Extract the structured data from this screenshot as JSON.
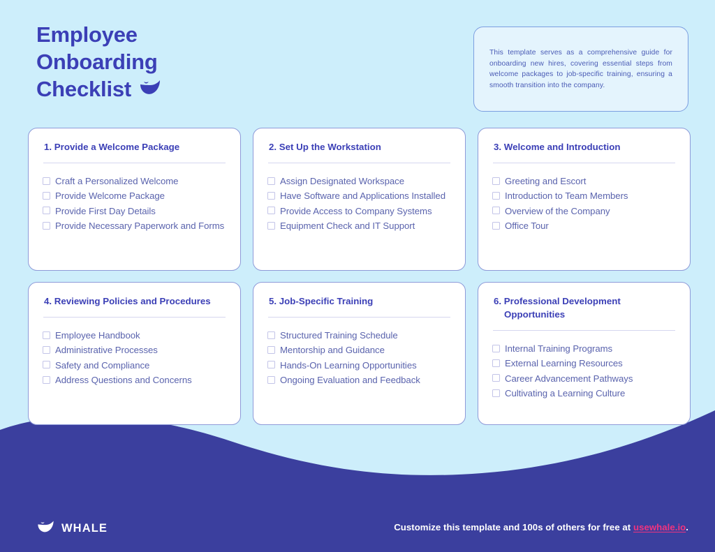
{
  "theme": {
    "background": "#cdeefb",
    "wave": "#3b3f9e",
    "primary_text": "#3b3fb6",
    "body_text": "#5a63ad",
    "card_bg": "#ffffff",
    "card_border": "#8e9ad8",
    "desc_bg": "#e4f4fd",
    "desc_border": "#7c9ee0",
    "link": "#f0337f",
    "checkbox_border": "#c3c4e8"
  },
  "header": {
    "title_lines": [
      "Employee",
      "Onboarding",
      "Checklist"
    ],
    "mark": "whale-smile-icon"
  },
  "description": {
    "text": "This template serves as a comprehensive guide for onboarding new hires, covering essential steps from welcome packages to job-specific training, ensuring a smooth transition into the company."
  },
  "cards": [
    {
      "title": "1. Provide a Welcome Package",
      "items": [
        "Craft a Personalized Welcome",
        "Provide Welcome Package",
        "Provide First Day Details",
        "Provide Necessary Paperwork and Forms"
      ]
    },
    {
      "title": "2. Set Up the Workstation",
      "items": [
        "Assign Designated Workspace",
        "Have Software and Applications Installed",
        "Provide Access to Company Systems",
        "Equipment Check and IT Support"
      ]
    },
    {
      "title": "3. Welcome and Introduction",
      "items": [
        "Greeting and Escort",
        "Introduction to Team Members",
        "Overview of the Company",
        "Office Tour"
      ]
    },
    {
      "title": "4. Reviewing Policies and Procedures",
      "items": [
        "Employee Handbook",
        "Administrative Processes",
        "Safety and Compliance",
        "Address Questions and Concerns"
      ]
    },
    {
      "title": "5. Job-Specific Training",
      "items": [
        "Structured Training Schedule",
        "Mentorship and Guidance",
        "Hands-On Learning Opportunities",
        "Ongoing Evaluation and Feedback"
      ]
    },
    {
      "title": "6. Professional Development Opportunities",
      "title_line_1": "6. Professional Development",
      "title_line_2": "Opportunities",
      "items": [
        "Internal Training Programs",
        "External Learning Resources",
        "Career Advancement Pathways",
        "Cultivating a Learning Culture"
      ]
    }
  ],
  "footer": {
    "logo_text": "WHALE",
    "logo_mark": "whale-smile-icon",
    "cta_prefix": "Customize this template and 100s of others for free at ",
    "cta_link": "usewhale.io",
    "cta_suffix": "."
  }
}
